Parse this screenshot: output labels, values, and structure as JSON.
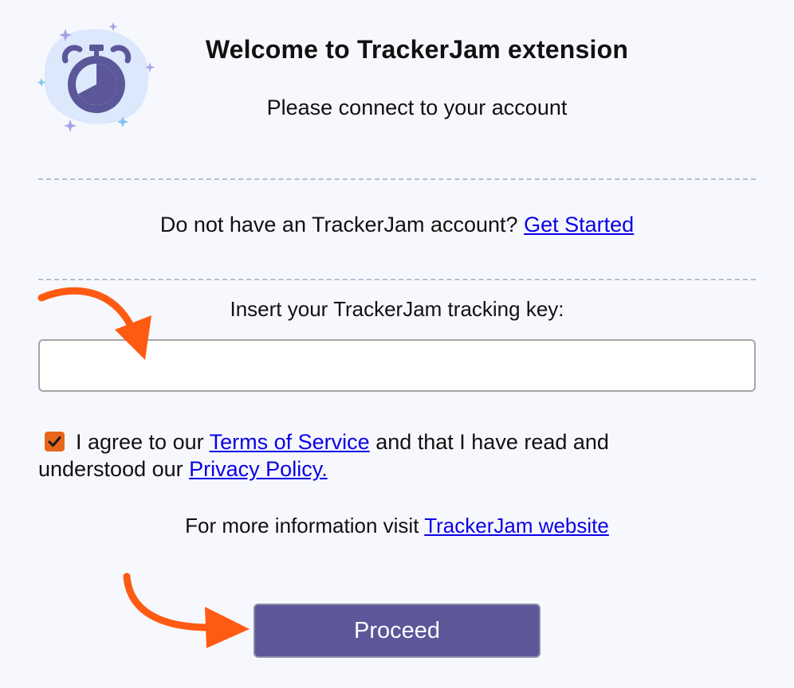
{
  "header": {
    "title": "Welcome to TrackerJam extension",
    "subtitle": "Please connect to your account"
  },
  "signup": {
    "text": "Do not have an TrackerJam account?",
    "link_label": "Get Started"
  },
  "tracking_key": {
    "label": "Insert your TrackerJam tracking key:",
    "value": "",
    "placeholder": ""
  },
  "agreement": {
    "checked": true,
    "text_before": "I agree to our",
    "terms_link": "Terms of Service",
    "text_middle": "and that I have read and understood our",
    "privacy_link": "Privacy Policy."
  },
  "info": {
    "text": "For more information visit",
    "link_label": "TrackerJam website"
  },
  "proceed_button": {
    "label": "Proceed"
  },
  "colors": {
    "background": "#f7f8fd",
    "accent": "#5b5799",
    "checkbox": "#e8661b",
    "annotation_arrow": "#ff5a12",
    "link": "#0a00e6"
  },
  "icons": {
    "logo": "stopwatch-icon",
    "annotation": "arrow-icon"
  }
}
